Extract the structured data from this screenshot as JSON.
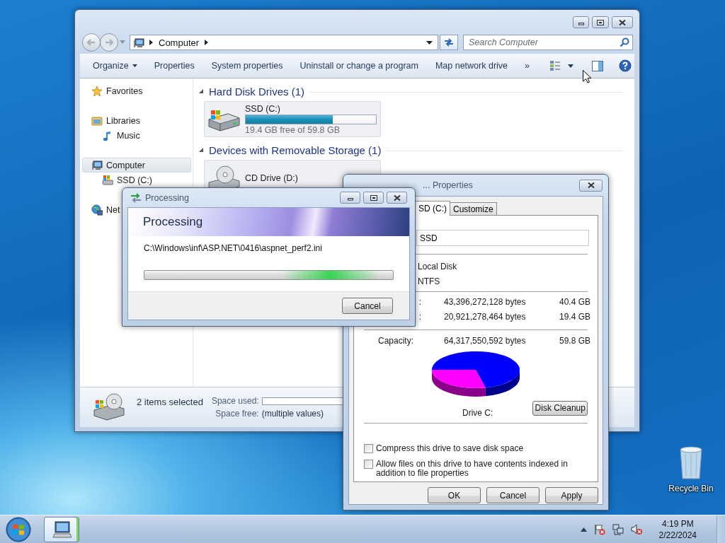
{
  "explorer": {
    "address": {
      "path": [
        "Computer"
      ]
    },
    "search": {
      "placeholder": "Search Computer"
    },
    "commands": [
      {
        "label": "Organize",
        "kind": "menu"
      },
      {
        "label": "Properties",
        "kind": "button"
      },
      {
        "label": "System properties",
        "kind": "button"
      },
      {
        "label": "Uninstall or change a program",
        "kind": "button"
      },
      {
        "label": "Map network drive",
        "kind": "button"
      },
      {
        "label": "»",
        "kind": "overflow"
      }
    ],
    "nav": [
      {
        "label": "Favorites",
        "kind": "favorites",
        "selected": false
      },
      {
        "label": "Libraries",
        "kind": "libraries",
        "selected": false,
        "children": [
          {
            "label": "Music",
            "kind": "music",
            "selected": false
          }
        ]
      },
      {
        "label": "Computer",
        "kind": "computer",
        "selected": true,
        "children": [
          {
            "label": "SSD (C:)",
            "kind": "drive",
            "selected": false
          }
        ]
      },
      {
        "label": "Net",
        "kind": "network",
        "selected": false
      }
    ],
    "groups": [
      {
        "title": "Hard Disk Drives (1)",
        "expanded": true,
        "items": [
          {
            "name": "SSD (C:)",
            "kind": "hdd",
            "selected": true,
            "level": 0.67,
            "free": "19.4 GB free of 59.8 GB"
          }
        ]
      },
      {
        "title": "Devices with Removable Storage (1)",
        "expanded": true,
        "items": [
          {
            "name": "CD Drive (D:)",
            "kind": "cd",
            "selected": true
          }
        ]
      }
    ],
    "details": {
      "summary": "2 items selected",
      "fields": [
        {
          "label": "Space used:",
          "kind": "bar",
          "level": 0
        },
        {
          "label": "Space free:",
          "kind": "text",
          "value": "(multiple values)"
        }
      ]
    }
  },
  "processing": {
    "title": "Processing",
    "indeterminate": true,
    "heading": "Processing",
    "file": "C:\\Windows\\inf\\ASP.NET\\0416\\aspnet_perf2.ini",
    "button": "Cancel"
  },
  "properties": {
    "title": "... Properties",
    "tabs": [
      {
        "label": "SD (C:)",
        "selected": true
      },
      {
        "label": "Customize",
        "selected": false
      }
    ],
    "name_value": "SSD",
    "type": "Local Disk",
    "filesystem": "NTFS",
    "space": [
      {
        "label": ":",
        "bytes": "43,396,272,128 bytes",
        "size": "40.4 GB"
      },
      {
        "label": ":",
        "bytes": "20,921,278,464 bytes",
        "size": "19.4 GB"
      }
    ],
    "capacity": {
      "label": "Capacity:",
      "bytes": "64,317,550,592 bytes",
      "size": "59.8 GB"
    },
    "drive_label": "Drive C:",
    "cleanup_button": "Disk Cleanup",
    "checkboxes": [
      {
        "label": "Compress this drive to save disk space",
        "checked": false
      },
      {
        "label": "Allow files on this drive to have contents indexed in addition to file properties",
        "checked": false
      }
    ],
    "buttons": [
      "OK",
      "Cancel",
      "Apply"
    ]
  },
  "desktop_icons": [
    {
      "label": "Recycle Bin",
      "kind": "recycle-bin"
    }
  ],
  "taskbar": {
    "buttons": [
      {
        "kind": "explorer",
        "active": true
      }
    ],
    "clock": {
      "time": "4:19 PM",
      "date": "2/22/2024"
    }
  }
}
